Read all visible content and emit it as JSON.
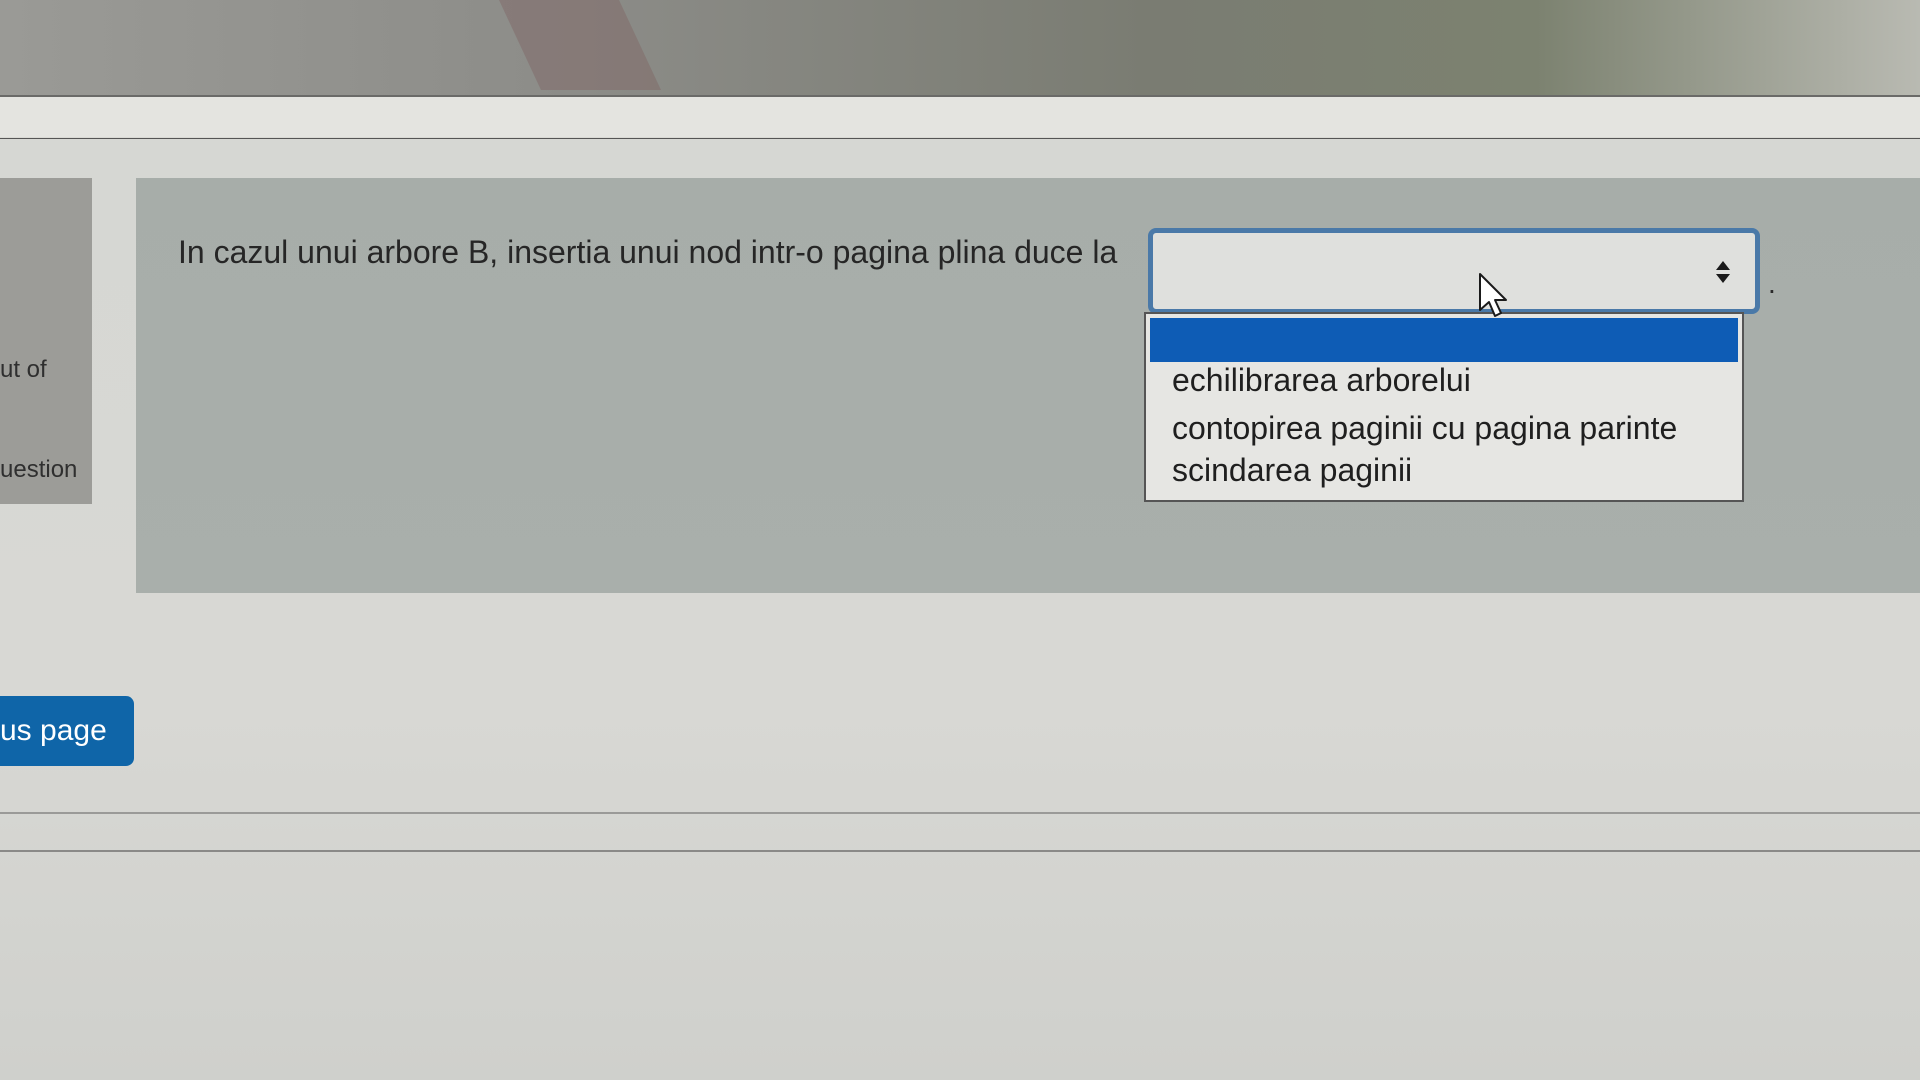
{
  "info_panel": {
    "line1": "ut of",
    "line2": "uestion"
  },
  "question": {
    "text": "In cazul unui arbore B, insertia unui nod intr-o pagina plina duce la",
    "after_select": ".",
    "select_value": ""
  },
  "dropdown": {
    "options": [
      "",
      "echilibrarea arborelui",
      "contopirea paginii cu pagina parinte",
      "scindarea paginii"
    ],
    "highlight_color": "#0e5cb5"
  },
  "navigation": {
    "previous_label": "us page"
  },
  "colors": {
    "button": "#0f65a8",
    "select_border": "#4a79a8"
  }
}
